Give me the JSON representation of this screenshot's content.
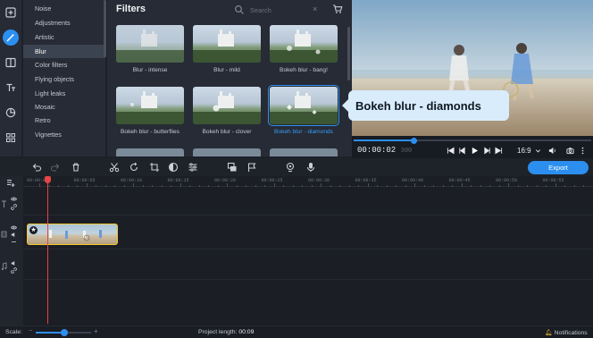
{
  "categories": [
    "Noise",
    "Adjustments",
    "Artistic",
    "Blur",
    "Color filters",
    "Flying objects",
    "Light leaks",
    "Mosaic",
    "Retro",
    "Vignettes"
  ],
  "active_category": "Blur",
  "filters_panel": {
    "title": "Filters",
    "search_placeholder": "Search",
    "clear_symbol": "×",
    "items": [
      {
        "label": "Blur - intense"
      },
      {
        "label": "Blur - mild"
      },
      {
        "label": "Bokeh blur - bang!"
      },
      {
        "label": "Bokeh blur - butterflies"
      },
      {
        "label": "Bokeh blur - clover"
      },
      {
        "label": "Bokeh blur - diamonds",
        "selected": true
      }
    ]
  },
  "tooltip": "Bokeh blur - diamonds",
  "player": {
    "timecode": "00:00:02",
    "frames": "300",
    "aspect": "16:9",
    "progress_fraction": 0.245
  },
  "toolbar": {
    "export_label": "Export"
  },
  "timeline": {
    "ruler_labels": [
      "00:00:00",
      "00:00:05",
      "00:00:10",
      "00:00:15",
      "00:00:20",
      "00:00:25",
      "00:00:30",
      "00:00:35",
      "00:00:40",
      "00:00:45",
      "00:00:50",
      "00:00:55"
    ]
  },
  "status": {
    "scale_label": "Scale:",
    "project_length_label": "Project length:",
    "project_length_value": "00:09",
    "notifications_label": "Notifications"
  },
  "colors": {
    "accent": "#2c8ff0",
    "clip_border": "#f5c431",
    "playhead": "#e64545",
    "tooltip_bg": "#d8ecfb"
  }
}
